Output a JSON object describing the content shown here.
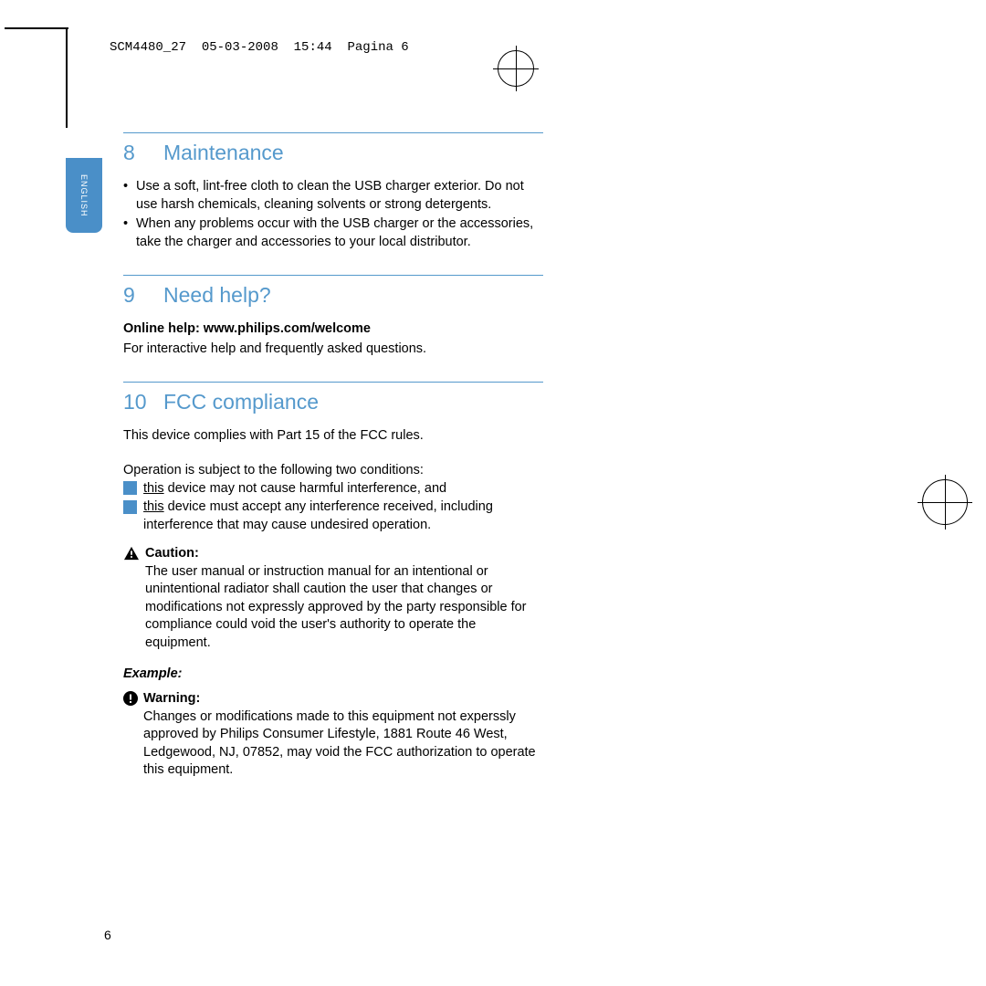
{
  "header": {
    "filename": "SCM4480_27",
    "date": "05-03-2008",
    "time": "15:44",
    "pageinfo": "Pagina 6"
  },
  "sideTab": "ENGLISH",
  "sections": {
    "maintenance": {
      "num": "8",
      "title": "Maintenance",
      "bullets": [
        "Use a soft, lint-free cloth to clean the USB charger exterior. Do not use harsh chemicals, cleaning solvents or strong detergents.",
        "When any problems occur with the USB charger or the accessories, take the charger and accessories to your local distributor."
      ]
    },
    "needhelp": {
      "num": "9",
      "title": "Need help?",
      "subhead": "Online help: www.philips.com/welcome",
      "text": "For interactive help and frequently asked questions."
    },
    "fcc": {
      "num": "10",
      "title": "FCC compliance",
      "intro": "This device complies with Part 15 of the FCC rules.",
      "condIntro": "Operation is subject to the following two conditions:",
      "cond1a": "this",
      "cond1b": " device may not cause harmful interference, and",
      "cond2a": "this",
      "cond2b": " device must accept any interference received, including interference that may cause undesired operation.",
      "cautionLabel": "Caution:",
      "cautionText": "The user manual or instruction manual for an intentional or unintentional radiator shall caution the user that changes or modifications not expressly approved by the party responsible for compliance could void the user's authority to operate the equipment.",
      "exampleLabel": "Example:",
      "warningLabel": "Warning:",
      "warningText": "Changes or modifications made to this equipment not experssly approved by Philips Consumer Lifestyle, 1881 Route 46 West, Ledgewood, NJ, 07852, may void the FCC authorization to operate this equipment."
    }
  },
  "pageNumber": "6"
}
